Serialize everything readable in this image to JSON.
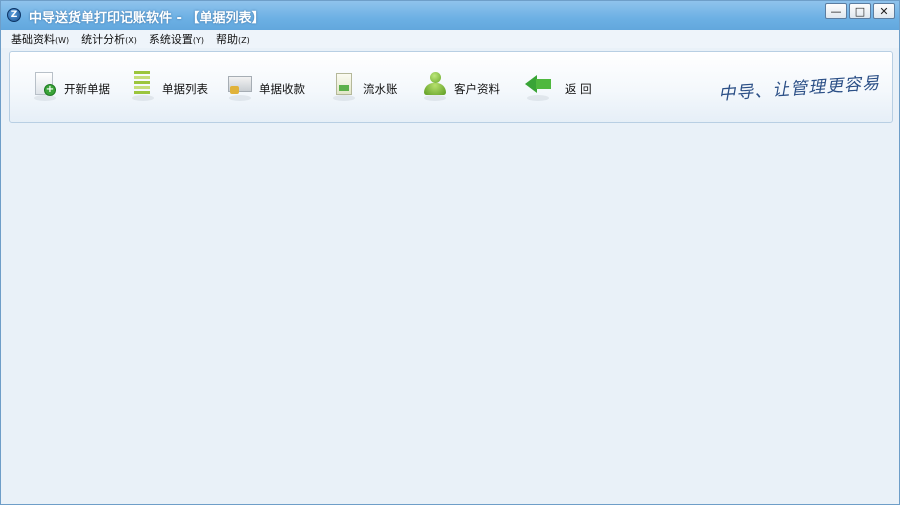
{
  "window": {
    "title": "中导送货单打印记账软件 - 【单据列表】",
    "app_icon": "app-logo-icon",
    "controls": [
      "minimize",
      "maximize",
      "close"
    ]
  },
  "menu": [
    {
      "label": "基础资料",
      "accel": "(W)"
    },
    {
      "label": "统计分析",
      "accel": "(X)"
    },
    {
      "label": "系统设置",
      "accel": "(Y)"
    },
    {
      "label": "帮助",
      "accel": "(Z)"
    }
  ],
  "toolbar": {
    "items": [
      {
        "label": "开新单据",
        "icon": "new-document-icon"
      },
      {
        "label": "单据列表",
        "icon": "document-list-icon"
      },
      {
        "label": "单据收款",
        "icon": "cash-register-icon"
      },
      {
        "label": "流水账",
        "icon": "ledger-icon"
      },
      {
        "label": "客户资料",
        "icon": "customer-icon"
      },
      {
        "label": "返 回",
        "icon": "back-arrow-icon"
      }
    ],
    "slogan": "中导、让管理更容易"
  },
  "colors": {
    "titlebar": "#6cb0e4",
    "workspace": "#e9f1f8",
    "accent_green": "#39a436"
  }
}
